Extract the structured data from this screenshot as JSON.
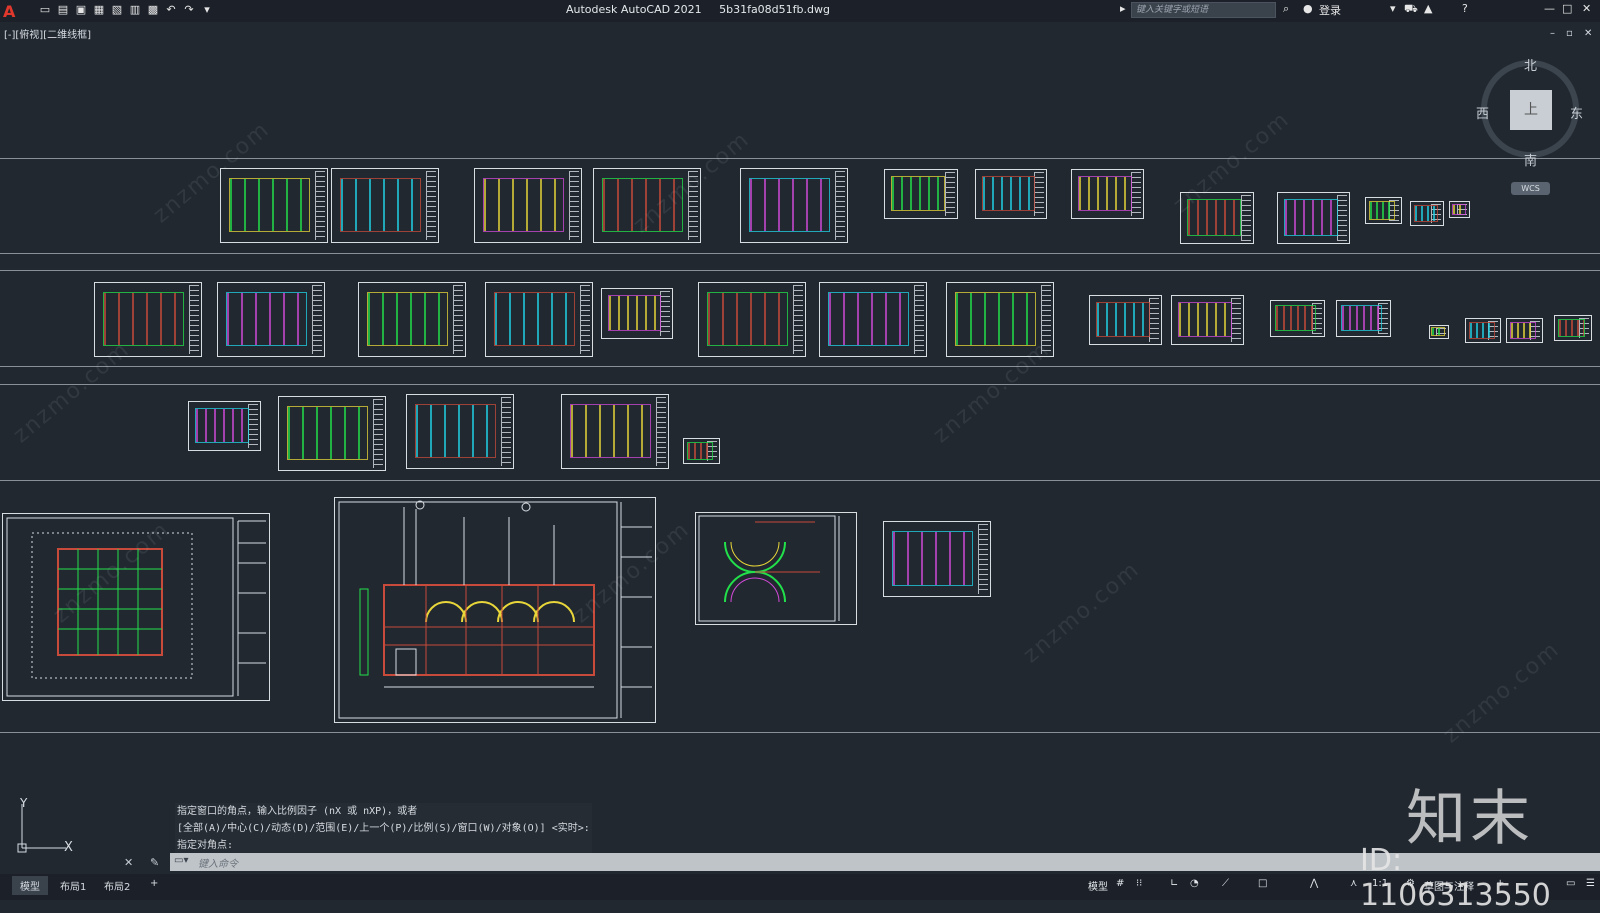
{
  "titlebar": {
    "app_title": "Autodesk AutoCAD 2021",
    "file_name": "5b31fa08d51fb.dwg",
    "search_placeholder": "键入关键字或短语",
    "login_label": "登录"
  },
  "viewport": {
    "label": "[-][俯视][二维线框]"
  },
  "viewcube": {
    "north": "北",
    "south": "南",
    "west": "西",
    "east": "东",
    "face": "上",
    "wcs_label": "WCS"
  },
  "command": {
    "history": [
      "指定窗口的角点，输入比例因子 (nX 或 nXP)，或者",
      "[全部(A)/中心(C)/动态(D)/范围(E)/上一个(P)/比例(S)/窗口(W)/对象(O)] <实时>:",
      "指定对角点:"
    ],
    "input_placeholder": "键入命令"
  },
  "layout_tabs": [
    "模型",
    "布局1",
    "布局2"
  ],
  "add_tab_label": "+",
  "status": {
    "model_label": "模型",
    "scale_label": "1:1",
    "workspace_label": "草图与注释"
  },
  "ucs": {
    "x_label": "X",
    "y_label": "Y"
  },
  "watermark": {
    "site": "znzmo.com",
    "brand": "知末",
    "id": "ID: 1106313550"
  },
  "colors": {
    "background": "#212830",
    "sheet_border": "#d8dde2",
    "drawing_green": "#22e04a",
    "drawing_cyan": "#22d3e6",
    "drawing_yellow": "#e8d63a",
    "drawing_red": "#c84a3a",
    "drawing_magenta": "#d24ad8"
  }
}
